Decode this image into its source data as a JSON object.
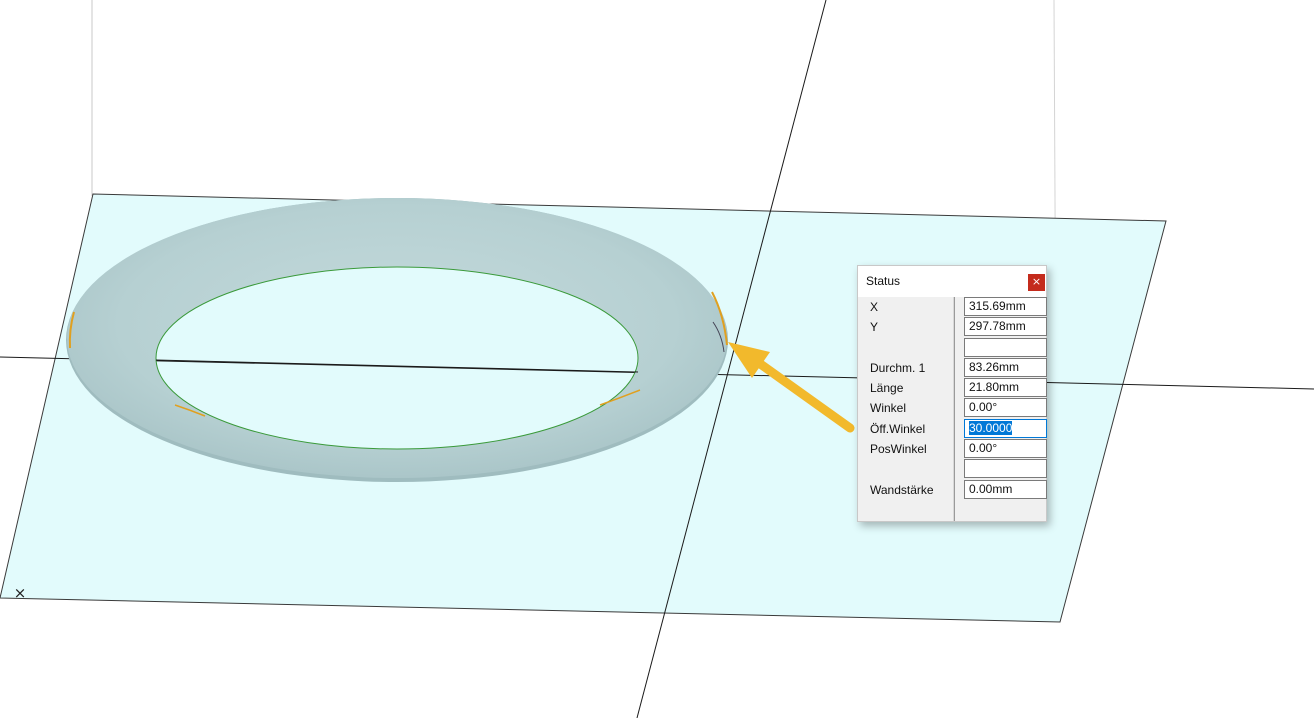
{
  "viewport": {
    "origin_marker": "×",
    "colors": {
      "plane_fill": "#e2fbfc",
      "ring_fill": "#b6d1d3",
      "inner_edge": "#3a9a3a",
      "arrow": "#f2b92c"
    }
  },
  "status_panel": {
    "title": "Status",
    "close_icon": "×",
    "rows": [
      {
        "label": "X",
        "value": "315.69mm"
      },
      {
        "label": "Y",
        "value": "297.78mm"
      },
      {
        "label": "",
        "value": ""
      },
      {
        "label": "Durchm. 1",
        "value": "83.26mm"
      },
      {
        "label": "Länge",
        "value": "21.80mm"
      },
      {
        "label": "Winkel",
        "value": "0.00°"
      },
      {
        "label": "Öff.Winkel",
        "value": "30.0000",
        "selected": true
      },
      {
        "label": "PosWinkel",
        "value": "0.00°"
      },
      {
        "label": "",
        "value": ""
      },
      {
        "label": "Wandstärke",
        "value": "0.00mm"
      }
    ]
  }
}
